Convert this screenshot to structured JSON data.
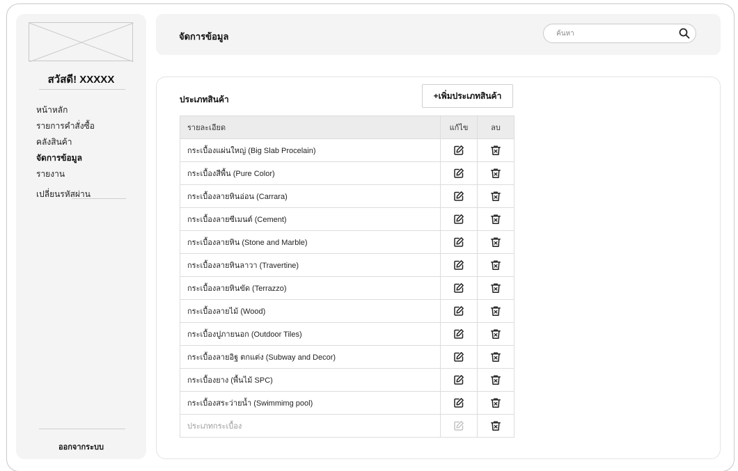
{
  "sidebar": {
    "greeting": "สวัสดี! XXXXX",
    "menu": [
      "หน้าหลัก",
      "รายการคำสั่งซื้อ",
      "คลังสินค้า",
      "จัดการข้อมูล",
      "รายงาน",
      "เปลี่ยนรหัสผ่าน"
    ],
    "active_index": 3,
    "logout": "ออกจากระบบ"
  },
  "header": {
    "title": "จัดการข้อมูล",
    "search_placeholder": "ค้นหา"
  },
  "section": {
    "title": "ประเภทสินค้า",
    "add_button": "+เพิ่มประเภทสินค้า"
  },
  "table": {
    "columns": [
      "รายละเอียด",
      "แก้ไข",
      "ลบ"
    ],
    "rows": [
      "กระเบื้องแผ่นใหญ่ (Big Slab Procelain)",
      "กระเบื้องสีพื้น (Pure Color)",
      "กระเบื้องลายหินอ่อน (Carrara)",
      "กระเบื้องลายซีเมนต์ (Cement)",
      "กระเบื้องลายหิน (Stone and Marble)",
      "กระเบื้องลายหินลาวา (Travertine)",
      "กระเบื้องลายหินขัด (Terrazzo)",
      "กระเบื้องลายไม้ (Wood)",
      "กระเบื้องปูภายนอก (Outdoor Tiles)",
      "กระเบื้องลายอิฐ ตกแต่ง (Subway and Decor)",
      "กระเบื้องยาง (พื้นไม้ SPC)",
      "กระเบื้องสระว่ายน้ำ (Swimmimg pool)"
    ],
    "new_row_placeholder": "ประเภทกระเบื้อง"
  },
  "icons": {
    "logo": "placeholder-image-icon",
    "search": "search-icon",
    "edit": "edit-icon",
    "delete": "trash-icon"
  },
  "colors": {
    "panel": "#f4f4f4",
    "border": "#dcdcdc",
    "table_header": "#ececec",
    "text": "#1f1f1f",
    "muted": "#9a9a9a"
  }
}
